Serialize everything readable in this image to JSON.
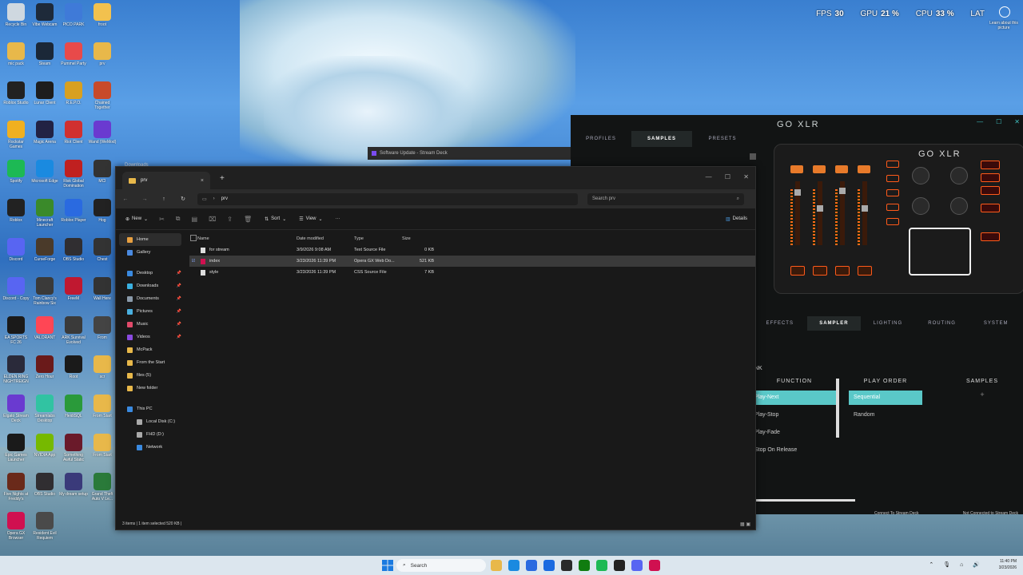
{
  "overlay": {
    "fps_label": "FPS",
    "fps_value": "30",
    "gpu_label": "GPU",
    "gpu_value": "21 %",
    "cpu_label": "CPU",
    "cpu_value": "33 %",
    "lat_label": "LAT",
    "learn": "Learn about this picture"
  },
  "desktop_icons": [
    {
      "label": "Recycle Bin",
      "color": "#cfd8e0"
    },
    {
      "label": "Vibe Webcam",
      "color": "#1e2a3a"
    },
    {
      "label": "PICO PARK",
      "color": "#3f7ad8"
    },
    {
      "label": "froot",
      "color": "#f2c14e"
    },
    {
      "label": "mic pack",
      "color": "#e8b84a"
    },
    {
      "label": "Steam",
      "color": "#1b2838"
    },
    {
      "label": "Pummel Party",
      "color": "#e84a4a"
    },
    {
      "label": "prv",
      "color": "#e8b84a"
    },
    {
      "label": "Roblox Studio",
      "color": "#222222"
    },
    {
      "label": "Lunar Client",
      "color": "#1d1d1d"
    },
    {
      "label": "R.E.P.O.",
      "color": "#d8a020"
    },
    {
      "label": "Chained Together",
      "color": "#c84a2a"
    },
    {
      "label": "Rockstar Games",
      "color": "#f0b020"
    },
    {
      "label": "Magic Arena",
      "color": "#222244"
    },
    {
      "label": "Riot Client",
      "color": "#d03030"
    },
    {
      "label": "Wand (WeMod)",
      "color": "#6a3ad0"
    },
    {
      "label": "Spotify",
      "color": "#1db954"
    },
    {
      "label": "Microsoft Edge",
      "color": "#1a8ae0"
    },
    {
      "label": "Risk Global Domination",
      "color": "#c02020"
    },
    {
      "label": "MCI",
      "color": "#333333"
    },
    {
      "label": "Roblox",
      "color": "#222222"
    },
    {
      "label": "Minecraft Launcher",
      "color": "#3a8a2a"
    },
    {
      "label": "Roblox Player",
      "color": "#2a6ae0"
    },
    {
      "label": "Hog",
      "color": "#222222"
    },
    {
      "label": "Discord",
      "color": "#5865f2"
    },
    {
      "label": "CurseForge",
      "color": "#4a3a2a"
    },
    {
      "label": "OBS Studio",
      "color": "#302e31"
    },
    {
      "label": "Chest",
      "color": "#333333"
    },
    {
      "label": "Discord - Copy",
      "color": "#5865f2"
    },
    {
      "label": "Tom Clancy's Rainbow Six",
      "color": "#3a3a3a"
    },
    {
      "label": "FreeM",
      "color": "#c01830"
    },
    {
      "label": "Wall Here",
      "color": "#333333"
    },
    {
      "label": "EA SPORTS FC 26",
      "color": "#1a1a1a"
    },
    {
      "label": "VALORANT",
      "color": "#ff4655"
    },
    {
      "label": "ARK Survival Evolved",
      "color": "#3a3a3a"
    },
    {
      "label": "From",
      "color": "#444444"
    },
    {
      "label": "ELDEN RING NIGHTREIGN",
      "color": "#2a2a3a"
    },
    {
      "label": "Zero Hour",
      "color": "#6a1a1a"
    },
    {
      "label": "Root",
      "color": "#1a1a1a"
    },
    {
      "label": "scr",
      "color": "#e8b84a"
    },
    {
      "label": "Elgato Stream Deck",
      "color": "#6a3ad0"
    },
    {
      "label": "Streamlabs Desktop",
      "color": "#31c3a2"
    },
    {
      "label": "HeidiSQL",
      "color": "#2a9a3a"
    },
    {
      "label": "From Start",
      "color": "#e8b84a"
    },
    {
      "label": "Epic Games Launcher",
      "color": "#1a1a1a"
    },
    {
      "label": "NVIDIA App",
      "color": "#76b900"
    },
    {
      "label": "Something Awful Static",
      "color": "#6a1a2a"
    },
    {
      "label": "From Start",
      "color": "#e8b84a"
    },
    {
      "label": "Five Nights at Freddy's",
      "color": "#6a2a1a"
    },
    {
      "label": "OBS Studio",
      "color": "#302e31"
    },
    {
      "label": "My dream setup",
      "color": "#3a3a7a"
    },
    {
      "label": "Grand Theft Auto V Le...",
      "color": "#2a7a3a"
    },
    {
      "label": "Opera GX Browser",
      "color": "#d01050"
    },
    {
      "label": "Resident Evil Requiem",
      "color": "#4a4a4a"
    }
  ],
  "stream_deck": {
    "title": "Software Update - Stream Deck"
  },
  "downloads_tab": {
    "title": "Downloads"
  },
  "explorer": {
    "tab_title": "prv",
    "tab_close": "×",
    "tab_add": "+",
    "win_min": "—",
    "win_max": "☐",
    "win_close": "✕",
    "nav_back": "←",
    "nav_forward": "→",
    "nav_up": "↑",
    "nav_refresh": "↻",
    "breadcrumb": "prv",
    "search_placeholder": "Search prv",
    "toolbar": {
      "new": "New",
      "sort": "Sort",
      "view": "View",
      "more": "···",
      "details": "Details"
    },
    "nav": [
      {
        "label": "Home",
        "color": "#e8a040",
        "selected": true
      },
      {
        "label": "Gallery",
        "color": "#4a8ae0"
      },
      {
        "label": "Desktop",
        "color": "#3a8ae0",
        "pinned": true
      },
      {
        "label": "Downloads",
        "color": "#3ab0e0",
        "pinned": true
      },
      {
        "label": "Documents",
        "color": "#8a9aaa",
        "pinned": true
      },
      {
        "label": "Pictures",
        "color": "#4ab0e0",
        "pinned": true
      },
      {
        "label": "Music",
        "color": "#e04a6a",
        "pinned": true
      },
      {
        "label": "Videos",
        "color": "#8a4ae0",
        "pinned": true
      },
      {
        "label": "McPack",
        "color": "#e8b84a"
      },
      {
        "label": "From the Start",
        "color": "#e8b84a"
      },
      {
        "label": "files (5)",
        "color": "#e8b84a"
      },
      {
        "label": "New folder",
        "color": "#e8b84a"
      },
      {
        "label": "This PC",
        "color": "#3a8ae0"
      },
      {
        "label": "Local Disk (C:)",
        "color": "#aaaaaa"
      },
      {
        "label": "FHD (D:)",
        "color": "#aaaaaa"
      },
      {
        "label": "Network",
        "color": "#3a8ae0"
      }
    ],
    "columns": {
      "name": "Name",
      "date": "Date modified",
      "type": "Type",
      "size": "Size"
    },
    "files": [
      {
        "name": "for stream",
        "date": "3/9/2026 9:08 AM",
        "type": "Text Source File",
        "size": "0 KB",
        "selected": false
      },
      {
        "name": "index",
        "date": "3/23/2026 11:39 PM",
        "type": "Opera GX Web Do...",
        "size": "521 KB",
        "selected": true
      },
      {
        "name": "style",
        "date": "3/23/2026 11:39 PM",
        "type": "CSS Source File",
        "size": "7 KB",
        "selected": false
      }
    ],
    "status": "3 items  |  1 item selected  520 KB  |"
  },
  "goxlr": {
    "title": "GO XLR",
    "top_tabs": [
      "PROFILES",
      "SAMPLES",
      "PRESETS"
    ],
    "active_top_tab": 1,
    "device_logo": "GO XLR",
    "bottom_tabs": [
      "EFFECTS",
      "SAMPLER",
      "LIGHTING",
      "ROUTING",
      "SYSTEM"
    ],
    "active_bottom_tab": 1,
    "section_label": "NK",
    "function_header": "FUNCTION",
    "functions": [
      "Play-Next",
      "Play-Stop",
      "Play-Fade",
      "Stop On Release"
    ],
    "active_function": 0,
    "playorder_header": "PLAY ORDER",
    "playorders": [
      "Sequential",
      "Random"
    ],
    "active_playorder": 0,
    "samples_header": "SAMPLES",
    "samples_add": "+",
    "footer_left": "Connect To Stream Deck",
    "footer_right": "Not Connected to Stream Deck",
    "accent": "#5ac8c8",
    "orange": "#ff5a1a"
  },
  "taskbar": {
    "search": "Search",
    "time": "11:40 PM",
    "date": "3/23/2026",
    "apps": [
      {
        "name": "file-explorer",
        "color": "#e8b84a"
      },
      {
        "name": "edge",
        "color": "#1a8ae0"
      },
      {
        "name": "store",
        "color": "#2a6ae0"
      },
      {
        "name": "mail",
        "color": "#1a6ae0"
      },
      {
        "name": "terminal",
        "color": "#2a2a2a"
      },
      {
        "name": "xbox",
        "color": "#107c10"
      },
      {
        "name": "spotify",
        "color": "#1db954"
      },
      {
        "name": "capcut",
        "color": "#222222"
      },
      {
        "name": "discord",
        "color": "#5865f2"
      },
      {
        "name": "opera-gx",
        "color": "#d01050"
      }
    ]
  }
}
